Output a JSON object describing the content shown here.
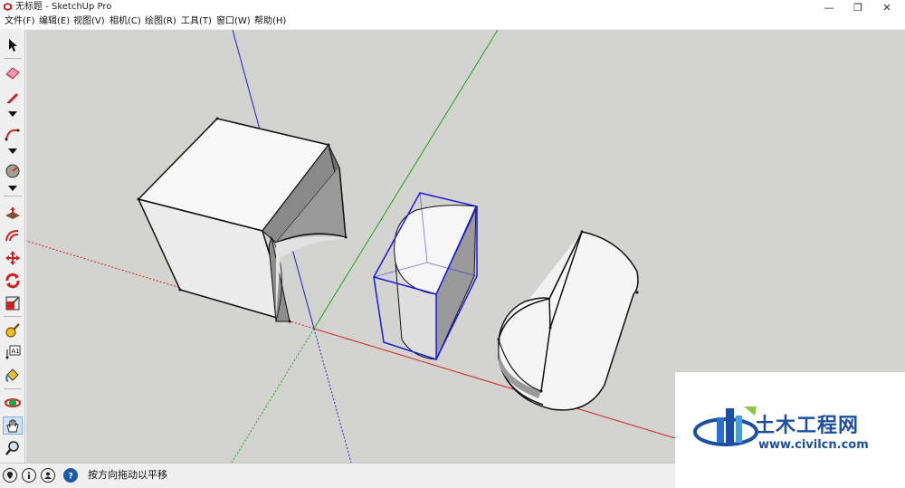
{
  "window": {
    "title": "无标题 - SketchUp Pro",
    "controls": {
      "minimize": "—",
      "restore": "❐",
      "close": "✕"
    }
  },
  "menu": {
    "items": [
      "文件(F)",
      "编辑(E)",
      "视图(V)",
      "相机(C)",
      "绘图(R)",
      "工具(T)",
      "窗口(W)",
      "帮助(H)"
    ]
  },
  "toolbar": {
    "tools": [
      {
        "name": "select-tool",
        "icon": "arrow-cursor-icon"
      },
      {
        "name": "eraser-tool",
        "icon": "eraser-icon"
      },
      {
        "name": "line-tool",
        "icon": "pencil-icon"
      },
      {
        "name": "arc-tool",
        "icon": "arc-icon"
      },
      {
        "name": "shape-tool",
        "icon": "shape-icon"
      },
      {
        "name": "push-pull-tool",
        "icon": "push-pull-icon"
      },
      {
        "name": "offset-tool",
        "icon": "offset-icon"
      },
      {
        "name": "move-tool",
        "icon": "move-icon"
      },
      {
        "name": "rotate-tool",
        "icon": "rotate-icon"
      },
      {
        "name": "scale-tool",
        "icon": "scale-icon"
      },
      {
        "name": "tape-measure-tool",
        "icon": "tape-measure-icon"
      },
      {
        "name": "text-tool",
        "icon": "text-icon"
      },
      {
        "name": "paint-bucket-tool",
        "icon": "paint-bucket-icon"
      },
      {
        "name": "orbit-tool",
        "icon": "orbit-icon"
      },
      {
        "name": "pan-tool",
        "icon": "hand-icon",
        "active": true
      },
      {
        "name": "zoom-tool",
        "icon": "magnifier-icon"
      }
    ],
    "text_tool_label": "A1"
  },
  "status": {
    "message": "按方向拖动以平移"
  },
  "watermark": {
    "title": "土木工程网",
    "url": "www.civilcn.com"
  },
  "colors": {
    "viewport_bg": "#d3d4cf",
    "axis_red": "#d02020",
    "axis_green": "#20a020",
    "axis_blue": "#2020d0",
    "selection_blue": "#1a1ae0",
    "watermark_blue": "#1c4fa1"
  }
}
